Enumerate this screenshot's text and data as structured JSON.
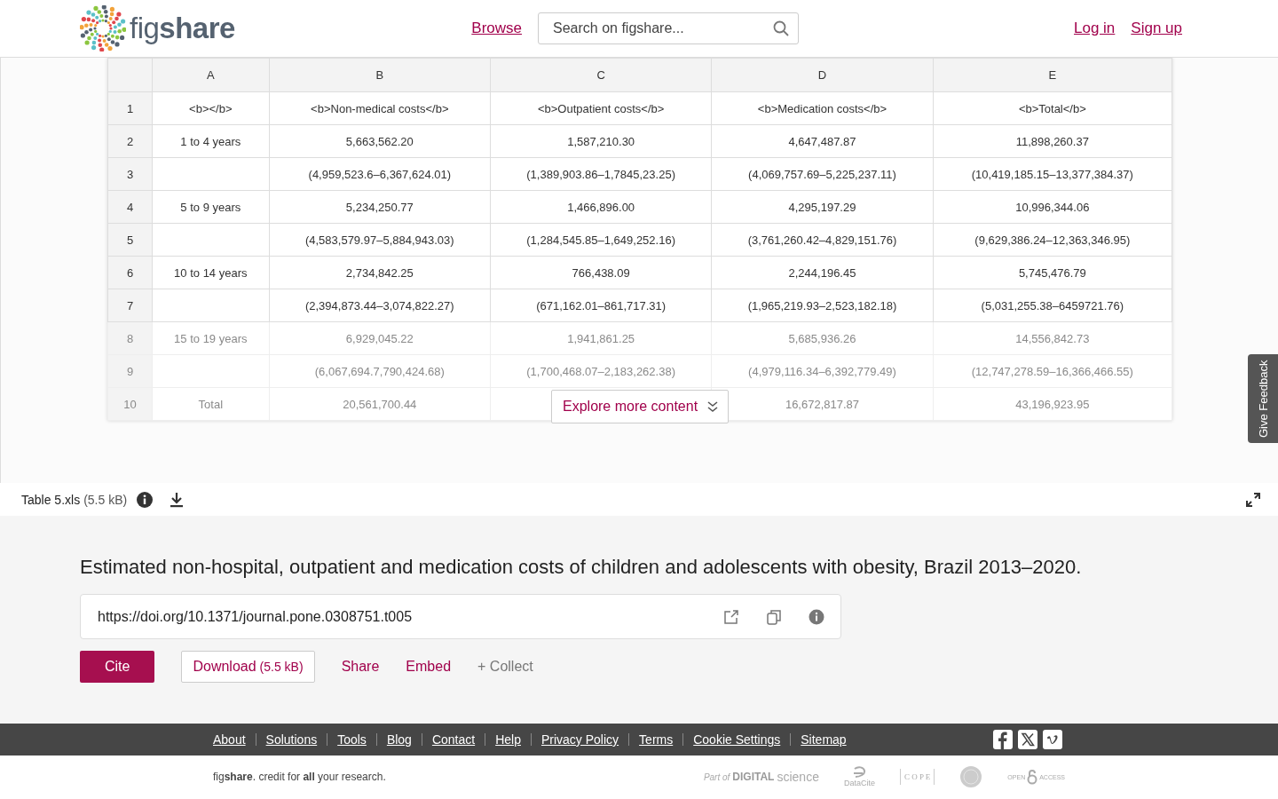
{
  "header": {
    "logo_text": "fig**share**",
    "nav": [
      {
        "label": "Browse"
      }
    ],
    "search": {
      "placeholder": "Search on figshare..."
    },
    "account_links": [
      {
        "label": "Log in"
      },
      {
        "label": "Sign up"
      }
    ]
  },
  "preview": {
    "columns": [
      "A",
      "B",
      "C",
      "D",
      "E"
    ],
    "rows": [
      {
        "row": "1",
        "cells": {
          "A": "<b></b>",
          "B": "<b>Non-medical costs</b>",
          "C": "<b>Outpatient costs</b>",
          "D": "<b>Medication costs</b>",
          "E": "<b>Total</b>"
        },
        "blurred": false
      },
      {
        "row": "2",
        "cells": {
          "A": "1 to 4 years",
          "B": "5,663,562.20",
          "C": "1,587,210.30",
          "D": "4,647,487.87",
          "E": "11,898,260.37"
        },
        "blurred": false
      },
      {
        "row": "3",
        "cells": {
          "B": "(4,959,523.6–6,367,624.01)",
          "C": "(1,389,903.86–1,7845,23.25)",
          "D": "(4,069,757.69–5,225,237.11)",
          "E": "(10,419,185.15–13,377,384.37)"
        },
        "blurred": false
      },
      {
        "row": "4",
        "cells": {
          "A": "5 to 9 years",
          "B": "5,234,250.77",
          "C": "1,466,896.00",
          "D": "4,295,197.29",
          "E": "10,996,344.06"
        },
        "blurred": false
      },
      {
        "row": "5",
        "cells": {
          "B": "(4,583,579.97–5,884,943.03)",
          "C": "(1,284,545.85–1,649,252.16)",
          "D": "(3,761,260.42–4,829,151.76)",
          "E": "(9,629,386.24–12,363,346.95)"
        },
        "blurred": false
      },
      {
        "row": "6",
        "cells": {
          "A": "10 to 14 years",
          "B": "2,734,842.25",
          "C": "766,438.09",
          "D": "2,244,196.45",
          "E": "5,745,476.79"
        },
        "blurred": false
      },
      {
        "row": "7",
        "cells": {
          "B": "(2,394,873.44–3,074,822.27)",
          "C": "(671,162.01–861,717.31)",
          "D": "(1,965,219.93–2,523,182.18)",
          "E": "(5,031,255.38–6459721.76)"
        },
        "blurred": false
      },
      {
        "row": "8",
        "cells": {
          "A": "15 to 19 years",
          "B": "6,929,045.22",
          "C": "1,941,861.25",
          "D": "5,685,936.26",
          "E": "14,556,842.73"
        },
        "blurred": true
      },
      {
        "row": "9",
        "cells": {
          "B": "(6,067,694.7,790,424.68)",
          "C": "(1,700,468.07–2,183,262.38)",
          "D": "(4,979,116.34–6,392,779.49)",
          "E": "(12,747,278.59–16,366,466.55)"
        },
        "blurred": true
      },
      {
        "row": "10",
        "cells": {
          "A": "Total",
          "B": "20,561,700.44",
          "D": "16,672,817.87",
          "E": "43,196,923.95"
        },
        "blurred": true
      }
    ],
    "explore_button": "Explore more content"
  },
  "file_bar": {
    "filename": "Table 5.xls",
    "size": "(5.5 kB)"
  },
  "feedback_tab": "Give Feedback",
  "item": {
    "title": "Estimated non-hospital, outpatient and medication costs of children and adolescents with obesity, Brazil 2013–2020.",
    "doi": "https://doi.org/10.1371/journal.pone.0308751.t005",
    "actions": [
      {
        "kind": "primary",
        "label": "Cite"
      },
      {
        "kind": "outline",
        "label": "Download",
        "size": "(5.5 kB)"
      },
      {
        "kind": "link",
        "label": "Share"
      },
      {
        "kind": "link",
        "label": "Embed"
      },
      {
        "kind": "muted",
        "label": "+ Collect"
      }
    ]
  },
  "footer": {
    "links": [
      "About",
      "Solutions",
      "Tools",
      "Blog",
      "Contact",
      "Help",
      "Privacy Policy",
      "Terms",
      "Cookie Settings",
      "Sitemap"
    ],
    "tagline": "fig**share**. credit for **all** your research.",
    "partners": [
      {
        "kind": "digital-science",
        "prefix": "Part of",
        "text": "DIGITAL",
        "suffix": "science"
      },
      {
        "kind": "datacite",
        "text": "DataCite"
      },
      {
        "kind": "cope",
        "text": "C O P E"
      },
      {
        "kind": "seal"
      },
      {
        "kind": "open-access",
        "text": "OPEN",
        "suffix": "ACCESS"
      }
    ]
  }
}
